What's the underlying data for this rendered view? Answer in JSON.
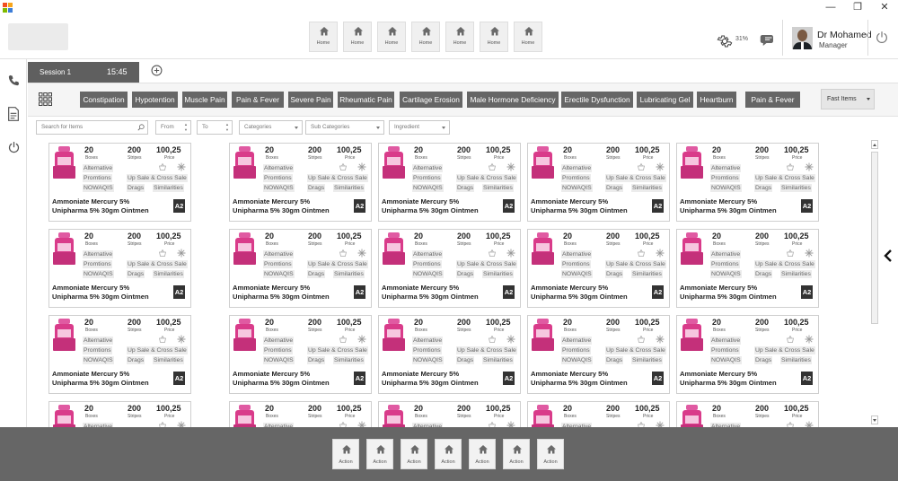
{
  "window": {
    "minimize_glyph": "—",
    "restore_glyph": "❐",
    "close_glyph": "✕"
  },
  "top_nav": {
    "items": [
      "Home",
      "Home",
      "Home",
      "Home",
      "Home",
      "Home",
      "Home"
    ]
  },
  "status": {
    "percent": "31%"
  },
  "user": {
    "name": "Dr Mohamed",
    "role": "Manager"
  },
  "session_tab": {
    "name": "Session 1",
    "time": "15:45"
  },
  "categories": [
    "Constipation",
    "Hypotention",
    "Muscle Pain",
    "Pain & Fever",
    "Severe Pain",
    "Rheumatic Pain",
    "Cartilage Erosion",
    "Male Hormone Deficiency",
    "Erectile Dysfunction",
    "Lubricating Gel",
    "Heartburn",
    "Pain & Fever"
  ],
  "fast_items": {
    "label": "Fast Items"
  },
  "filters": {
    "search_placeholder": "Search for Items",
    "from_label": "From",
    "to_label": "To",
    "categories_label": "Categories",
    "sub_categories_label": "Sub Categories",
    "ingredient_label": "Ingredient"
  },
  "product_card": {
    "boxes_value": "20",
    "boxes_label": "Boxes",
    "stripes_value": "200",
    "stripes_label": "Stripes",
    "price_value": "100,25",
    "price_label": "Price",
    "alternative": "Alternative",
    "promotions": "Promtions",
    "upsale": "Up Sale & Cross Sale",
    "nowaqis": "NOWAQIS",
    "drags": "Drags",
    "similarities": "Similarities",
    "name_line1": "Ammoniate Mercury 5%",
    "name_line2": "Unipharma 5% 30gm Ointmen",
    "grade": "A2"
  },
  "bottom_actions": [
    "Action",
    "Action",
    "Action",
    "Action",
    "Action",
    "Action",
    "Action"
  ],
  "colors": {
    "accent_dark": "#666666",
    "tab_bg": "#5f5f5f",
    "product_pink": "#d93b8a"
  },
  "icons": {
    "nav": "home-icon",
    "settings": "gear-icon",
    "chat": "chat-icon",
    "power": "power-icon",
    "phone": "phone-icon",
    "document": "document-icon",
    "grid": "grid-icon"
  }
}
